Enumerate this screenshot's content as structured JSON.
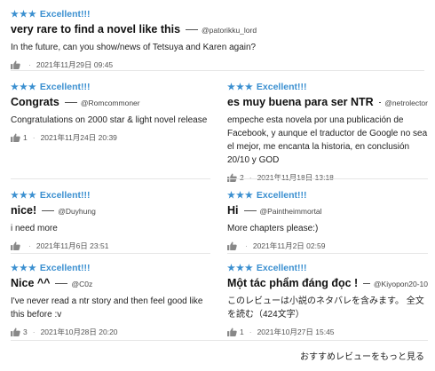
{
  "rating_label": "Excellent!!!",
  "stars_glyph": "★★★",
  "reviews": [
    {
      "title": "very rare to find a novel like this",
      "author": "@patorikku_lord",
      "body": [
        "In the future, can you show/news of Tetsuya and Karen again?"
      ],
      "likes": "",
      "date": "2021年11月29日 09:45"
    },
    {
      "title": "Congrats",
      "author": "@Romcommoner",
      "body": [
        "Congratulations on 2000 star & light novel release"
      ],
      "likes": "1",
      "date": "2021年11月24日 20:39"
    },
    {
      "title": "es muy buena para ser NTR",
      "author": "@netrolector",
      "body": [
        "empeche esta novela por una publicación de",
        "Facebook, y aunque el traductor de Google no sea",
        "el mejor, me encanta la historia, en conclusión",
        "20/10 y GOD"
      ],
      "likes": "2",
      "date": "2021年11月18日 13:18"
    },
    {
      "title": "nice!",
      "author": "@Duyhung",
      "body": [
        "i need more"
      ],
      "likes": "",
      "date": "2021年11月6日 23:51"
    },
    {
      "title": "Hi",
      "author": "@Paintheimmortal",
      "body": [
        "More chapters please:)"
      ],
      "likes": "",
      "date": "2021年11月2日 02:59"
    },
    {
      "title": "Nice ^^",
      "author": "@C0z",
      "body": [
        "I've never read a ntr story and then feel good like",
        "this before :v"
      ],
      "likes": "3",
      "date": "2021年10月28日 20:20"
    },
    {
      "title": "Một tác phẩm đáng đọc !",
      "author": "@Kiyopon20-10",
      "body": [
        "このレビューは小説のネタバレを含みます。 全文",
        "を読む（424文字）"
      ],
      "likes": "1",
      "date": "2021年10月27日 15:45"
    }
  ],
  "more_link": "おすすめレビューをもっと見る"
}
